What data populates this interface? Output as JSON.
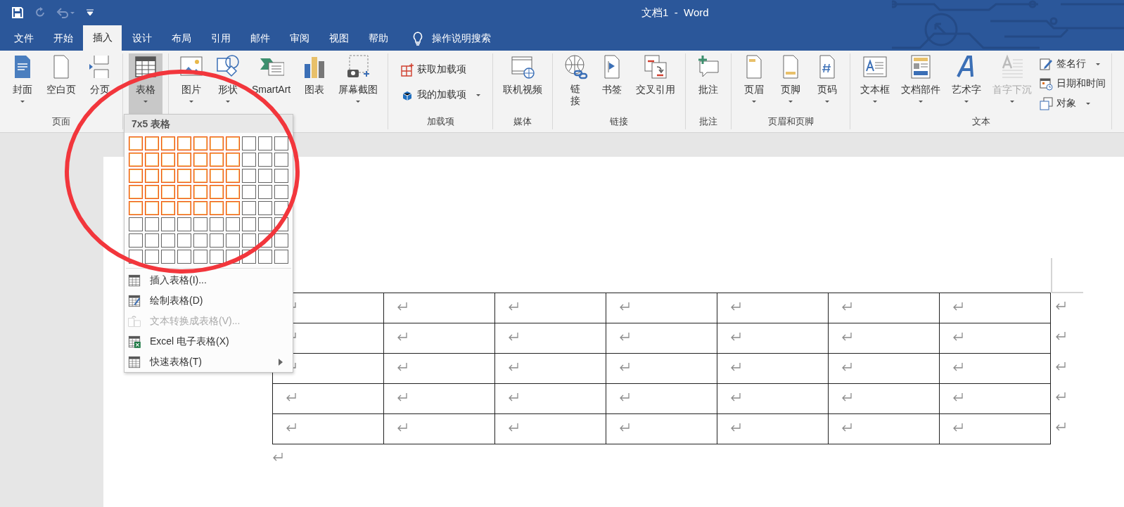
{
  "window": {
    "title": "文档1  -  Word"
  },
  "tabs": [
    {
      "label": "文件",
      "selected": false
    },
    {
      "label": "开始",
      "selected": false
    },
    {
      "label": "插入",
      "selected": true
    },
    {
      "label": "设计",
      "selected": false
    },
    {
      "label": "布局",
      "selected": false
    },
    {
      "label": "引用",
      "selected": false
    },
    {
      "label": "邮件",
      "selected": false
    },
    {
      "label": "审阅",
      "selected": false
    },
    {
      "label": "视图",
      "selected": false
    },
    {
      "label": "帮助",
      "selected": false
    }
  ],
  "tell_me": {
    "placeholder": "操作说明搜索"
  },
  "ribbon_groups": [
    {
      "label": "页面",
      "buttons": [
        {
          "label": "封面",
          "kind": "large",
          "dropdown": true,
          "pressed": false,
          "disabled": false
        },
        {
          "label": "空白页",
          "kind": "large",
          "dropdown": false,
          "pressed": false,
          "disabled": false
        },
        {
          "label": "分页",
          "kind": "large",
          "pressed": false,
          "disabled": false
        }
      ]
    },
    {
      "buttons": [
        {
          "label": "表格",
          "kind": "large",
          "dropdown": true,
          "pressed": true,
          "disabled": false
        }
      ]
    },
    {
      "buttons": [
        {
          "label": "图片",
          "kind": "large",
          "dropdown": true,
          "pressed": false,
          "disabled": false
        },
        {
          "label": "形状",
          "kind": "large",
          "dropdown": true,
          "pressed": false,
          "disabled": false
        },
        {
          "label": "SmartArt",
          "kind": "large",
          "dropdown": false,
          "pressed": false,
          "disabled": false
        },
        {
          "label": "图表",
          "kind": "large",
          "dropdown": false,
          "pressed": false,
          "disabled": false
        },
        {
          "label": "屏幕截图",
          "kind": "large",
          "dropdown": true,
          "pressed": false,
          "disabled": false
        }
      ]
    },
    {
      "label": "加载项",
      "buttons": [
        {
          "label": "获取加载项",
          "kind": "small",
          "dropdown": false,
          "pressed": false,
          "disabled": false
        },
        {
          "label": "我的加载项",
          "kind": "small",
          "dropdown": true,
          "pressed": false,
          "disabled": false
        }
      ]
    },
    {
      "label": "媒体",
      "buttons": [
        {
          "label": "联机视频",
          "kind": "large",
          "dropdown": false,
          "pressed": false,
          "disabled": false
        }
      ]
    },
    {
      "label": "链接",
      "buttons": [
        {
          "label": "链接",
          "kind": "large",
          "dropdown": false,
          "pressed": false,
          "disabled": false
        },
        {
          "label": "书签",
          "kind": "large",
          "dropdown": false,
          "pressed": false,
          "disabled": false
        },
        {
          "label": "交叉引用",
          "kind": "large",
          "dropdown": false,
          "pressed": false,
          "disabled": false
        }
      ]
    },
    {
      "label": "批注",
      "buttons": [
        {
          "label": "批注",
          "kind": "large",
          "dropdown": false,
          "pressed": false,
          "disabled": false
        }
      ]
    },
    {
      "label": "页眉和页脚",
      "buttons": [
        {
          "label": "页眉",
          "kind": "large",
          "dropdown": true,
          "pressed": false,
          "disabled": false
        },
        {
          "label": "页脚",
          "kind": "large",
          "dropdown": true,
          "pressed": false,
          "disabled": false
        },
        {
          "label": "页码",
          "kind": "large",
          "dropdown": true,
          "pressed": false,
          "disabled": false
        }
      ]
    },
    {
      "label": "文本",
      "buttons": [
        {
          "label": "文本框",
          "kind": "large",
          "dropdown": true,
          "pressed": false,
          "disabled": false
        },
        {
          "label": "文档部件",
          "kind": "large",
          "dropdown": true,
          "pressed": false,
          "disabled": false
        },
        {
          "label": "艺术字",
          "kind": "large",
          "dropdown": true,
          "pressed": false,
          "disabled": false
        },
        {
          "label": "首字下沉",
          "kind": "large",
          "dropdown": true,
          "pressed": false,
          "disabled": true
        },
        {
          "label": "签名行",
          "kind": "small",
          "dropdown": true,
          "pressed": false,
          "disabled": false
        },
        {
          "label": "日期和时间",
          "kind": "small",
          "dropdown": false,
          "pressed": false,
          "disabled": false
        },
        {
          "label": "对象",
          "kind": "small",
          "dropdown": true,
          "pressed": false,
          "disabled": false
        }
      ]
    }
  ],
  "table_menu": {
    "header": "7x5 表格",
    "grid": [
      {
        "cells": [
          {
            "selected": true
          },
          {
            "selected": true
          },
          {
            "selected": true
          },
          {
            "selected": true
          },
          {
            "selected": true
          },
          {
            "selected": true
          },
          {
            "selected": true
          },
          {
            "selected": false
          },
          {
            "selected": false
          },
          {
            "selected": false
          }
        ]
      },
      {
        "cells": [
          {
            "selected": true
          },
          {
            "selected": true
          },
          {
            "selected": true
          },
          {
            "selected": true
          },
          {
            "selected": true
          },
          {
            "selected": true
          },
          {
            "selected": true
          },
          {
            "selected": false
          },
          {
            "selected": false
          },
          {
            "selected": false
          }
        ]
      },
      {
        "cells": [
          {
            "selected": true
          },
          {
            "selected": true
          },
          {
            "selected": true
          },
          {
            "selected": true
          },
          {
            "selected": true
          },
          {
            "selected": true
          },
          {
            "selected": true
          },
          {
            "selected": false
          },
          {
            "selected": false
          },
          {
            "selected": false
          }
        ]
      },
      {
        "cells": [
          {
            "selected": true
          },
          {
            "selected": true
          },
          {
            "selected": true
          },
          {
            "selected": true
          },
          {
            "selected": true
          },
          {
            "selected": true
          },
          {
            "selected": true
          },
          {
            "selected": false
          },
          {
            "selected": false
          },
          {
            "selected": false
          }
        ]
      },
      {
        "cells": [
          {
            "selected": true
          },
          {
            "selected": true
          },
          {
            "selected": true
          },
          {
            "selected": true
          },
          {
            "selected": true
          },
          {
            "selected": true
          },
          {
            "selected": true
          },
          {
            "selected": false
          },
          {
            "selected": false
          },
          {
            "selected": false
          }
        ]
      },
      {
        "cells": [
          {
            "selected": false
          },
          {
            "selected": false
          },
          {
            "selected": false
          },
          {
            "selected": false
          },
          {
            "selected": false
          },
          {
            "selected": false
          },
          {
            "selected": false
          },
          {
            "selected": false
          },
          {
            "selected": false
          },
          {
            "selected": false
          }
        ]
      },
      {
        "cells": [
          {
            "selected": false
          },
          {
            "selected": false
          },
          {
            "selected": false
          },
          {
            "selected": false
          },
          {
            "selected": false
          },
          {
            "selected": false
          },
          {
            "selected": false
          },
          {
            "selected": false
          },
          {
            "selected": false
          },
          {
            "selected": false
          }
        ]
      },
      {
        "cells": [
          {
            "selected": false
          },
          {
            "selected": false
          },
          {
            "selected": false
          },
          {
            "selected": false
          },
          {
            "selected": false
          },
          {
            "selected": false
          },
          {
            "selected": false
          },
          {
            "selected": false
          },
          {
            "selected": false
          },
          {
            "selected": false
          }
        ]
      }
    ],
    "items": [
      {
        "label": "插入表格(I)...",
        "disabled": false,
        "submenu": false
      },
      {
        "label": "绘制表格(D)",
        "disabled": false,
        "submenu": false
      },
      {
        "label": "文本转换成表格(V)...",
        "disabled": true,
        "submenu": false
      },
      {
        "label": "Excel 电子表格(X)",
        "disabled": false,
        "submenu": false
      },
      {
        "label": "快速表格(T)",
        "disabled": false,
        "submenu": true
      }
    ]
  },
  "document": {
    "table": {
      "rows": [
        {
          "cells": [
            {
              "kind": "paragraph_mark"
            },
            {
              "kind": "paragraph_mark"
            },
            {
              "kind": "paragraph_mark"
            },
            {
              "kind": "paragraph_mark"
            },
            {
              "kind": "paragraph_mark"
            },
            {
              "kind": "paragraph_mark"
            },
            {
              "kind": "paragraph_mark"
            }
          ]
        },
        {
          "cells": [
            {
              "kind": "paragraph_mark"
            },
            {
              "kind": "paragraph_mark"
            },
            {
              "kind": "paragraph_mark"
            },
            {
              "kind": "paragraph_mark"
            },
            {
              "kind": "paragraph_mark"
            },
            {
              "kind": "paragraph_mark"
            },
            {
              "kind": "paragraph_mark"
            }
          ]
        },
        {
          "cells": [
            {
              "kind": "paragraph_mark"
            },
            {
              "kind": "paragraph_mark"
            },
            {
              "kind": "paragraph_mark"
            },
            {
              "kind": "paragraph_mark"
            },
            {
              "kind": "paragraph_mark"
            },
            {
              "kind": "paragraph_mark"
            },
            {
              "kind": "paragraph_mark"
            }
          ]
        },
        {
          "cells": [
            {
              "kind": "paragraph_mark"
            },
            {
              "kind": "paragraph_mark"
            },
            {
              "kind": "paragraph_mark"
            },
            {
              "kind": "paragraph_mark"
            },
            {
              "kind": "paragraph_mark"
            },
            {
              "kind": "paragraph_mark"
            },
            {
              "kind": "paragraph_mark"
            }
          ]
        },
        {
          "cells": [
            {
              "kind": "paragraph_mark"
            },
            {
              "kind": "paragraph_mark"
            },
            {
              "kind": "paragraph_mark"
            },
            {
              "kind": "paragraph_mark"
            },
            {
              "kind": "paragraph_mark"
            },
            {
              "kind": "paragraph_mark"
            },
            {
              "kind": "paragraph_mark"
            }
          ]
        }
      ]
    },
    "after_table": {
      "kind": "paragraph_mark"
    }
  },
  "annotations": [
    {
      "kind": "circle"
    }
  ]
}
